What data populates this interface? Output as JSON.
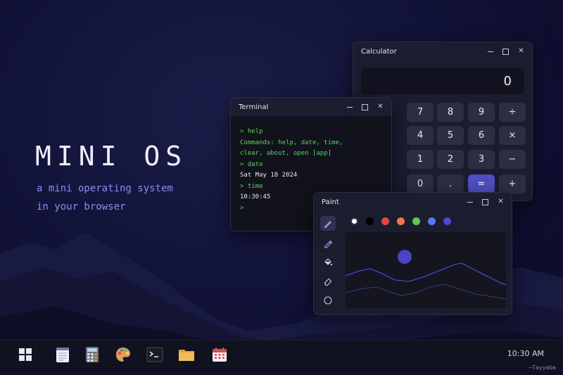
{
  "hero": {
    "title": "MINI OS",
    "subtitle_line1": "a mini operating system",
    "subtitle_line2": "in your browser"
  },
  "calculator": {
    "title": "Calculator",
    "display": "0",
    "buttons": [
      [
        "7",
        "8",
        "9",
        "÷"
      ],
      [
        "4",
        "5",
        "6",
        "×"
      ],
      [
        "1",
        "2",
        "3",
        "−"
      ],
      [
        "0",
        ".",
        "=",
        "+"
      ]
    ]
  },
  "terminal": {
    "title": "Terminal",
    "lines": [
      {
        "text": "> help",
        "color": "green"
      },
      {
        "text": "Commands: help, date, time,",
        "color": "green"
      },
      {
        "text": "clear, about, open [app]",
        "color": "green"
      },
      {
        "text": "> date",
        "color": "green"
      },
      {
        "text": "Sat May 18 2024",
        "color": "white"
      },
      {
        "text": "> time",
        "color": "green"
      },
      {
        "text": "10:30:45",
        "color": "white"
      },
      {
        "text": ">",
        "color": "green"
      }
    ]
  },
  "paint": {
    "title": "Paint",
    "tools": [
      "pencil-icon",
      "marker-icon",
      "fill-bucket-icon",
      "eraser-icon",
      "circle-icon"
    ],
    "palette": [
      "#ffffff",
      "#000000",
      "#e04848",
      "#f07840",
      "#60c850",
      "#5878e8",
      "#4848d8"
    ],
    "selected_color": "#ffffff"
  },
  "window_controls": {
    "minimize": "–",
    "maximize": "□",
    "close": "✕"
  },
  "taskbar": {
    "apps": [
      "start-icon",
      "notes-icon",
      "calculator-icon",
      "paint-icon",
      "terminal-icon",
      "folder-icon",
      "calendar-icon"
    ],
    "clock": "10:30 AM"
  },
  "signature": "~Tayyaba",
  "colors": {
    "accent": "#4f4fc4",
    "subtitle": "#8d8cf0",
    "terminal_green": "#5ed35e",
    "background": "#12133a"
  }
}
